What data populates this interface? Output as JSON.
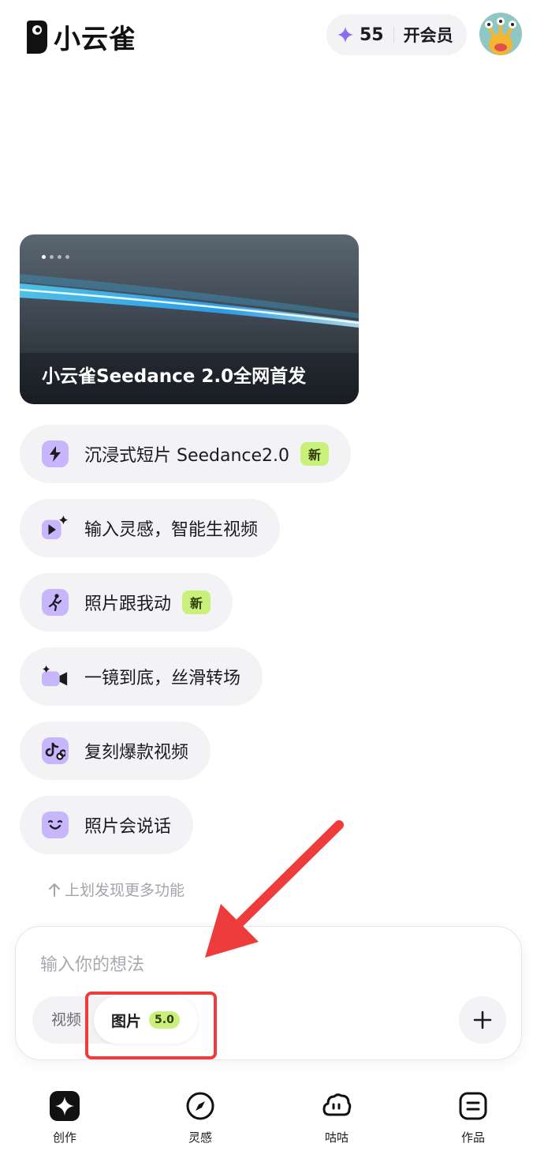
{
  "header": {
    "logo_text": "小云雀",
    "credits": "55",
    "vip_label": "开会员"
  },
  "banner": {
    "title": "小云雀Seedance 2.0全网首发",
    "slide_count": 4,
    "active_slide": 1
  },
  "features": [
    {
      "label": "沉浸式短片 Seedance2.0",
      "badge": "新",
      "icon": "lightning-icon"
    },
    {
      "label": "输入灵感，智能生视频",
      "badge": "",
      "icon": "play-sparkle-icon"
    },
    {
      "label": "照片跟我动",
      "badge": "新",
      "icon": "running-person-icon"
    },
    {
      "label": "一镜到底，丝滑转场",
      "badge": "",
      "icon": "video-camera-icon"
    },
    {
      "label": "复刻爆款视频",
      "badge": "",
      "icon": "tiktok-link-icon"
    },
    {
      "label": "照片会说话",
      "badge": "",
      "icon": "smile-face-icon"
    }
  ],
  "hint": "上划发现更多功能",
  "composer": {
    "placeholder": "输入你的想法",
    "mode_video": "视频",
    "mode_image": "图片",
    "mode_image_version": "5.0"
  },
  "nav": [
    {
      "label": "创作",
      "icon": "create-sparkle-icon"
    },
    {
      "label": "灵感",
      "icon": "compass-icon"
    },
    {
      "label": "咕咕",
      "icon": "cloud-face-icon"
    },
    {
      "label": "作品",
      "icon": "works-list-icon"
    }
  ],
  "colors": {
    "accent_purple": "#c7b6fb",
    "badge_green": "#c8f07b",
    "annotation_red": "#ee3b3b"
  }
}
